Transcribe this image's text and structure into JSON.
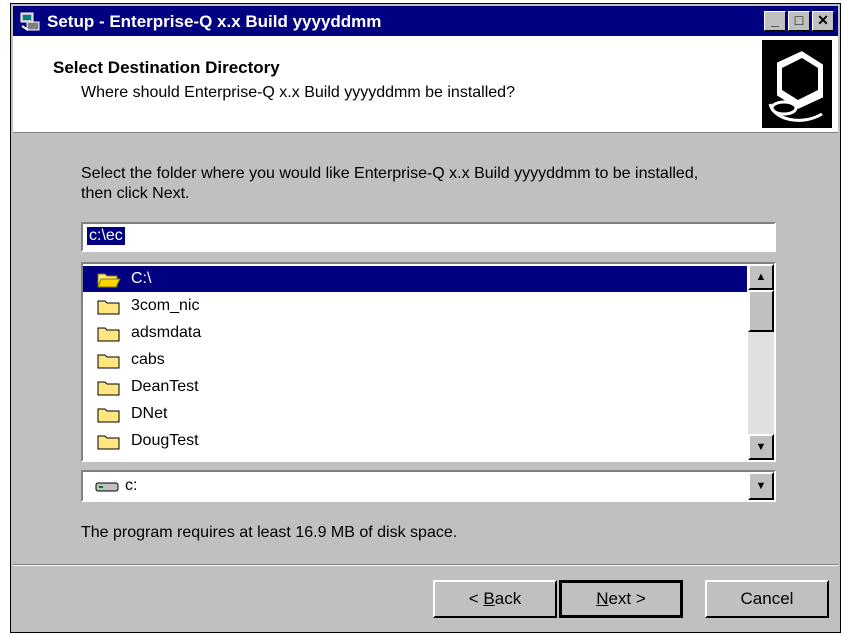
{
  "window": {
    "title": "Setup - Enterprise-Q x.x Build yyyyddmm"
  },
  "titlebar_buttons": {
    "minimize": "_",
    "maximize": "□",
    "close": "✕"
  },
  "header": {
    "title": "Select Destination Directory",
    "subtitle": "Where should Enterprise-Q x.x Build yyyyddmm be installed?"
  },
  "instruction": {
    "line1": "Select the folder where you would like Enterprise-Q x.x Build yyyyddmm to be installed,",
    "line2": "then click Next."
  },
  "path_input": {
    "value": "c:\\ec"
  },
  "folders": [
    {
      "label": "C:\\",
      "selected": true,
      "open": true
    },
    {
      "label": "3com_nic"
    },
    {
      "label": "adsmdata"
    },
    {
      "label": "cabs"
    },
    {
      "label": "DeanTest"
    },
    {
      "label": "DNet"
    },
    {
      "label": "DougTest"
    }
  ],
  "drive_select": {
    "value": "c:"
  },
  "disk_space": "The program requires at least 16.9 MB of disk space.",
  "buttons": {
    "back_mnemonic": "B",
    "back_rest": "ack",
    "back_prefix": "< ",
    "next_mnemonic": "N",
    "next_rest": "ext >",
    "cancel": "Cancel"
  },
  "colors": {
    "titlebar": "#000080",
    "face": "#c0c0c0",
    "selection": "#000080",
    "folder": "#ffe680"
  }
}
